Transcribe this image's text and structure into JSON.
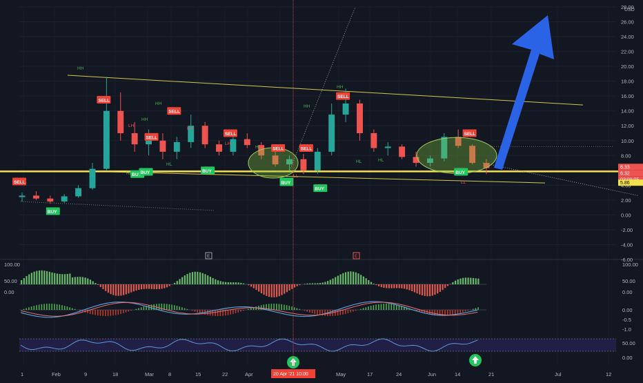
{
  "chart_data": {
    "type": "candlestick",
    "symbol_currency": "USD",
    "price_axis": {
      "ticks": [
        "28.00",
        "26.00",
        "24.00",
        "22.00",
        "20.00",
        "18.00",
        "16.00",
        "14.00",
        "12.00",
        "10.00",
        "8.00",
        "6.00",
        "4.00",
        "2.00",
        "0.00",
        "-2.00",
        "-4.00",
        "-6.00"
      ],
      "ylim": [
        -6,
        28
      ],
      "last_price": "6.33",
      "last_price_2": "6.32",
      "countdown": "02:09:05",
      "level_price": "5.86"
    },
    "time_axis": {
      "labels": [
        "1",
        "Feb",
        "9",
        "18",
        "Mar",
        "8",
        "15",
        "22",
        "Apr",
        "12",
        "May",
        "17",
        "24",
        "Jun",
        "14",
        "21",
        "Jul",
        "12"
      ],
      "crosshair_label": "20 Apr '21  10:00"
    },
    "price_series": [
      {
        "t": 1,
        "o": 2.4,
        "h": 3.0,
        "l": 1.8,
        "c": 2.6
      },
      {
        "t": 2,
        "o": 2.6,
        "h": 3.2,
        "l": 2.0,
        "c": 2.2
      },
      {
        "t": 3,
        "o": 2.2,
        "h": 2.6,
        "l": 1.5,
        "c": 1.8
      },
      {
        "t": 4,
        "o": 1.8,
        "h": 2.8,
        "l": 1.6,
        "c": 2.5
      },
      {
        "t": 5,
        "o": 2.5,
        "h": 4.0,
        "l": 2.3,
        "c": 3.6
      },
      {
        "t": 6,
        "o": 3.6,
        "h": 7.0,
        "l": 3.4,
        "c": 6.2
      },
      {
        "t": 7,
        "o": 6.2,
        "h": 18.6,
        "l": 6.0,
        "c": 14.0
      },
      {
        "t": 8,
        "o": 14.0,
        "h": 16.5,
        "l": 10.0,
        "c": 11.0
      },
      {
        "t": 9,
        "o": 11.0,
        "h": 12.5,
        "l": 8.5,
        "c": 9.5
      },
      {
        "t": 10,
        "o": 9.5,
        "h": 11.5,
        "l": 8.0,
        "c": 10.0
      },
      {
        "t": 11,
        "o": 10.0,
        "h": 11.0,
        "l": 7.5,
        "c": 8.5
      },
      {
        "t": 12,
        "o": 8.5,
        "h": 10.5,
        "l": 7.5,
        "c": 9.8
      },
      {
        "t": 13,
        "o": 9.8,
        "h": 13.5,
        "l": 9.0,
        "c": 12.0
      },
      {
        "t": 14,
        "o": 12.0,
        "h": 12.5,
        "l": 9.0,
        "c": 9.5
      },
      {
        "t": 15,
        "o": 9.5,
        "h": 10.0,
        "l": 8.0,
        "c": 8.5
      },
      {
        "t": 16,
        "o": 8.5,
        "h": 10.5,
        "l": 8.0,
        "c": 10.2
      },
      {
        "t": 17,
        "o": 10.2,
        "h": 11.0,
        "l": 9.0,
        "c": 9.4
      },
      {
        "t": 18,
        "o": 9.4,
        "h": 9.8,
        "l": 7.5,
        "c": 8.0
      },
      {
        "t": 19,
        "o": 8.0,
        "h": 8.5,
        "l": 6.5,
        "c": 6.8
      },
      {
        "t": 20,
        "o": 6.8,
        "h": 8.0,
        "l": 6.0,
        "c": 7.5
      },
      {
        "t": 21,
        "o": 7.5,
        "h": 8.2,
        "l": 5.5,
        "c": 6.0
      },
      {
        "t": 22,
        "o": 6.0,
        "h": 9.0,
        "l": 5.5,
        "c": 8.5
      },
      {
        "t": 23,
        "o": 8.5,
        "h": 15.0,
        "l": 8.0,
        "c": 13.5
      },
      {
        "t": 24,
        "o": 13.5,
        "h": 17.0,
        "l": 12.5,
        "c": 15.0
      },
      {
        "t": 25,
        "o": 15.0,
        "h": 15.5,
        "l": 10.0,
        "c": 11.0
      },
      {
        "t": 26,
        "o": 11.0,
        "h": 11.5,
        "l": 8.5,
        "c": 9.0
      },
      {
        "t": 27,
        "o": 9.0,
        "h": 9.8,
        "l": 8.0,
        "c": 9.2
      },
      {
        "t": 28,
        "o": 9.2,
        "h": 9.5,
        "l": 7.5,
        "c": 7.8
      },
      {
        "t": 29,
        "o": 7.8,
        "h": 8.5,
        "l": 6.5,
        "c": 7.0
      },
      {
        "t": 30,
        "o": 7.0,
        "h": 8.0,
        "l": 6.5,
        "c": 7.6
      },
      {
        "t": 31,
        "o": 7.6,
        "h": 11.0,
        "l": 7.2,
        "c": 10.5
      },
      {
        "t": 32,
        "o": 10.5,
        "h": 11.5,
        "l": 9.0,
        "c": 9.3
      },
      {
        "t": 33,
        "o": 9.3,
        "h": 9.5,
        "l": 6.8,
        "c": 7.0
      },
      {
        "t": 34,
        "o": 7.0,
        "h": 7.5,
        "l": 5.5,
        "c": 6.3
      }
    ],
    "markers": [
      {
        "label": "SELL",
        "kind": "sell",
        "t": 1,
        "price": 4.5
      },
      {
        "label": "BUY",
        "kind": "buy",
        "t": 3,
        "price": 0.5
      },
      {
        "label": "SELL",
        "kind": "sell",
        "t": 7,
        "price": 15.5
      },
      {
        "label": "BUY",
        "kind": "buy",
        "t": 9,
        "price": 5.5
      },
      {
        "label": "BUY",
        "kind": "buy",
        "t": 10,
        "price": 5.8
      },
      {
        "label": "SELL",
        "kind": "sell",
        "t": 10,
        "price": 10.5
      },
      {
        "label": "SELL",
        "kind": "sell",
        "t": 12,
        "price": 14.0
      },
      {
        "label": "BUY",
        "kind": "buy",
        "t": 14,
        "price": 6.0
      },
      {
        "label": "SELL",
        "kind": "sell",
        "t": 16,
        "price": 11.0
      },
      {
        "label": "SELL",
        "kind": "sell",
        "t": 19,
        "price": 9.0
      },
      {
        "label": "BUY",
        "kind": "buy",
        "t": 20,
        "price": 4.5
      },
      {
        "label": "SELL",
        "kind": "sell",
        "t": 21,
        "price": 9.0
      },
      {
        "label": "BUY",
        "kind": "buy",
        "t": 20,
        "price": 4.4
      },
      {
        "label": "BUY",
        "kind": "buy",
        "t": 22,
        "price": 3.6
      },
      {
        "label": "SELL",
        "kind": "sell",
        "t": 24,
        "price": 16.0
      },
      {
        "label": "BUY",
        "kind": "buy",
        "t": 32,
        "price": 5.8
      },
      {
        "label": "SELL",
        "kind": "sell",
        "t": 33,
        "price": 11.0
      }
    ],
    "swing_labels": [
      "HH",
      "HH",
      "HH",
      "HH",
      "HH",
      "LH",
      "LH",
      "LH",
      "HL",
      "HL",
      "HL",
      "HL",
      "HL",
      "LL",
      "LL"
    ],
    "indicator_panes": [
      {
        "name": "momentum_histogram",
        "ticks": [
          "100.00",
          "50.00",
          "0.00"
        ]
      },
      {
        "name": "macd",
        "ticks": [
          "0.00",
          "-0.5",
          "-1.0"
        ]
      },
      {
        "name": "rsi",
        "ticks": [
          "50.00",
          "0.00"
        ],
        "bands": [
          30,
          70
        ]
      }
    ],
    "event_markers": [
      "E",
      "E"
    ],
    "colors": {
      "background": "#131722",
      "up": "#26a69a",
      "down": "#ef5350",
      "buy": "#22c55e",
      "sell": "#ef4136",
      "trendline": "#d4c84a",
      "support": "#f5e14b",
      "arrow": "#2b63e6",
      "zone": "#7fbf3f",
      "rsi_band": "#2a2357"
    }
  }
}
